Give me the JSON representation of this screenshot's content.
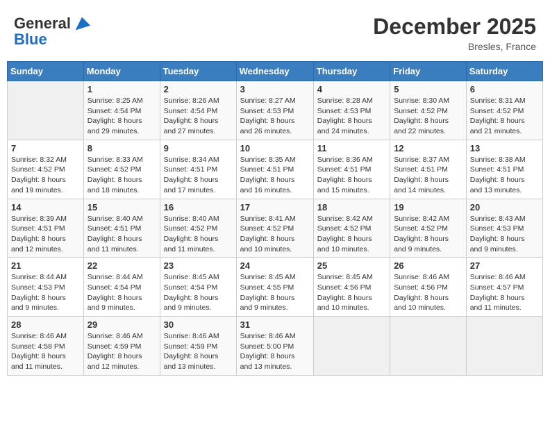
{
  "header": {
    "logo_line1": "General",
    "logo_line2": "Blue",
    "month_title": "December 2025",
    "location": "Bresles, France"
  },
  "weekdays": [
    "Sunday",
    "Monday",
    "Tuesday",
    "Wednesday",
    "Thursday",
    "Friday",
    "Saturday"
  ],
  "weeks": [
    [
      {
        "day": "",
        "info": ""
      },
      {
        "day": "1",
        "info": "Sunrise: 8:25 AM\nSunset: 4:54 PM\nDaylight: 8 hours\nand 29 minutes."
      },
      {
        "day": "2",
        "info": "Sunrise: 8:26 AM\nSunset: 4:54 PM\nDaylight: 8 hours\nand 27 minutes."
      },
      {
        "day": "3",
        "info": "Sunrise: 8:27 AM\nSunset: 4:53 PM\nDaylight: 8 hours\nand 26 minutes."
      },
      {
        "day": "4",
        "info": "Sunrise: 8:28 AM\nSunset: 4:53 PM\nDaylight: 8 hours\nand 24 minutes."
      },
      {
        "day": "5",
        "info": "Sunrise: 8:30 AM\nSunset: 4:52 PM\nDaylight: 8 hours\nand 22 minutes."
      },
      {
        "day": "6",
        "info": "Sunrise: 8:31 AM\nSunset: 4:52 PM\nDaylight: 8 hours\nand 21 minutes."
      }
    ],
    [
      {
        "day": "7",
        "info": "Sunrise: 8:32 AM\nSunset: 4:52 PM\nDaylight: 8 hours\nand 19 minutes."
      },
      {
        "day": "8",
        "info": "Sunrise: 8:33 AM\nSunset: 4:52 PM\nDaylight: 8 hours\nand 18 minutes."
      },
      {
        "day": "9",
        "info": "Sunrise: 8:34 AM\nSunset: 4:51 PM\nDaylight: 8 hours\nand 17 minutes."
      },
      {
        "day": "10",
        "info": "Sunrise: 8:35 AM\nSunset: 4:51 PM\nDaylight: 8 hours\nand 16 minutes."
      },
      {
        "day": "11",
        "info": "Sunrise: 8:36 AM\nSunset: 4:51 PM\nDaylight: 8 hours\nand 15 minutes."
      },
      {
        "day": "12",
        "info": "Sunrise: 8:37 AM\nSunset: 4:51 PM\nDaylight: 8 hours\nand 14 minutes."
      },
      {
        "day": "13",
        "info": "Sunrise: 8:38 AM\nSunset: 4:51 PM\nDaylight: 8 hours\nand 13 minutes."
      }
    ],
    [
      {
        "day": "14",
        "info": "Sunrise: 8:39 AM\nSunset: 4:51 PM\nDaylight: 8 hours\nand 12 minutes."
      },
      {
        "day": "15",
        "info": "Sunrise: 8:40 AM\nSunset: 4:51 PM\nDaylight: 8 hours\nand 11 minutes."
      },
      {
        "day": "16",
        "info": "Sunrise: 8:40 AM\nSunset: 4:52 PM\nDaylight: 8 hours\nand 11 minutes."
      },
      {
        "day": "17",
        "info": "Sunrise: 8:41 AM\nSunset: 4:52 PM\nDaylight: 8 hours\nand 10 minutes."
      },
      {
        "day": "18",
        "info": "Sunrise: 8:42 AM\nSunset: 4:52 PM\nDaylight: 8 hours\nand 10 minutes."
      },
      {
        "day": "19",
        "info": "Sunrise: 8:42 AM\nSunset: 4:52 PM\nDaylight: 8 hours\nand 9 minutes."
      },
      {
        "day": "20",
        "info": "Sunrise: 8:43 AM\nSunset: 4:53 PM\nDaylight: 8 hours\nand 9 minutes."
      }
    ],
    [
      {
        "day": "21",
        "info": "Sunrise: 8:44 AM\nSunset: 4:53 PM\nDaylight: 8 hours\nand 9 minutes."
      },
      {
        "day": "22",
        "info": "Sunrise: 8:44 AM\nSunset: 4:54 PM\nDaylight: 8 hours\nand 9 minutes."
      },
      {
        "day": "23",
        "info": "Sunrise: 8:45 AM\nSunset: 4:54 PM\nDaylight: 8 hours\nand 9 minutes."
      },
      {
        "day": "24",
        "info": "Sunrise: 8:45 AM\nSunset: 4:55 PM\nDaylight: 8 hours\nand 9 minutes."
      },
      {
        "day": "25",
        "info": "Sunrise: 8:45 AM\nSunset: 4:56 PM\nDaylight: 8 hours\nand 10 minutes."
      },
      {
        "day": "26",
        "info": "Sunrise: 8:46 AM\nSunset: 4:56 PM\nDaylight: 8 hours\nand 10 minutes."
      },
      {
        "day": "27",
        "info": "Sunrise: 8:46 AM\nSunset: 4:57 PM\nDaylight: 8 hours\nand 11 minutes."
      }
    ],
    [
      {
        "day": "28",
        "info": "Sunrise: 8:46 AM\nSunset: 4:58 PM\nDaylight: 8 hours\nand 11 minutes."
      },
      {
        "day": "29",
        "info": "Sunrise: 8:46 AM\nSunset: 4:59 PM\nDaylight: 8 hours\nand 12 minutes."
      },
      {
        "day": "30",
        "info": "Sunrise: 8:46 AM\nSunset: 4:59 PM\nDaylight: 8 hours\nand 13 minutes."
      },
      {
        "day": "31",
        "info": "Sunrise: 8:46 AM\nSunset: 5:00 PM\nDaylight: 8 hours\nand 13 minutes."
      },
      {
        "day": "",
        "info": ""
      },
      {
        "day": "",
        "info": ""
      },
      {
        "day": "",
        "info": ""
      }
    ]
  ]
}
